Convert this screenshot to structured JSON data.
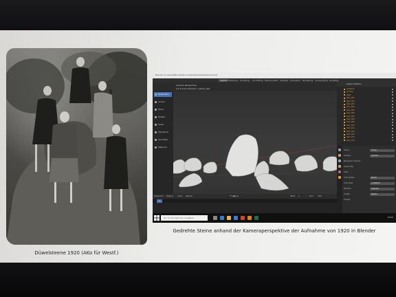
{
  "left_photo": {
    "caption": "Düwelsteene 1920 (AKo für Westf.)"
  },
  "right_figure": {
    "caption": "Gedrehte Steine anhand der Kameraperspektive der Aufnahme von 1920 in Blender"
  },
  "blender": {
    "window_title": "Blender [C:\\Users\\Blender\\Documents\\Duewelsteene.blend]",
    "workspace_tabs": [
      "Layout",
      "Modeling",
      "Sculpting",
      "UV Editing",
      "Texture Paint",
      "Shading",
      "Animation",
      "Rendering",
      "Compositing",
      "Scripting"
    ],
    "active_workspace": "Layout",
    "viewport_overlay_1": "Camera Perspective",
    "viewport_overlay_2": "(1) Scene Collection | steine_001",
    "tools": [
      "Select Box",
      "Cursor",
      "Move",
      "Rotate",
      "Scale",
      "Transform",
      "Annotate",
      "Measure"
    ],
    "active_tool": "Select Box",
    "outliner_title": "Scene Collection",
    "outliner_items": [
      "Collection",
      "Camera",
      "Light",
      "stein_001",
      "stein_002",
      "stein_003",
      "stein_004",
      "stein_005",
      "stein_006",
      "stein_007",
      "stein_008",
      "stein_009",
      "stein_010",
      "stein_011",
      "stein_012",
      "stein_013",
      "stein_014",
      "stein_015"
    ],
    "properties_rows": [
      {
        "label": "Scene",
        "value": "Scene"
      },
      {
        "label": "Camera",
        "value": "Camera"
      },
      {
        "label": "Background Scene",
        "value": ""
      },
      {
        "label": "Active Clip",
        "value": ""
      },
      {
        "label": "Units",
        "value": ""
      },
      {
        "label": "Unit System",
        "value": "Metric"
      },
      {
        "label": "Unit Scale",
        "value": "1.000000"
      },
      {
        "label": "Rotation",
        "value": "Degrees"
      },
      {
        "label": "Length",
        "value": "Meters"
      },
      {
        "label": "Gravity",
        "value": ""
      }
    ],
    "timeline_labels": {
      "playback": "Playback",
      "keying": "Keying",
      "view": "View",
      "marker": "Marker",
      "start": "Start",
      "end": "End"
    },
    "current_frame": "1",
    "start_frame": "1",
    "end_frame": "250",
    "taskbar_search": "Zur Suche Text hier eingeben",
    "clock": "14:02"
  }
}
